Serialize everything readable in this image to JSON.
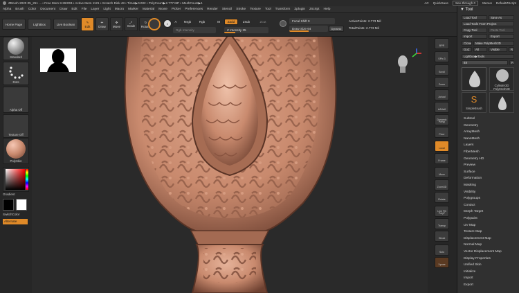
{
  "titlebar": {
    "text": "ZBrush 2020    05_251 ... • Free Mem 8.263GB • Active Mem 1121 • Scratch Disk 48 • Timer▶0.002 • PolyCount▶2.777 MP • MeshCount▶1",
    "ac": "AC",
    "quicksave": "QuickSave",
    "see_through": "See-through  0",
    "menus": "Menus",
    "script": "DefaultZScript"
  },
  "menubar": {
    "items": [
      "Alpha",
      "Brush",
      "Color",
      "Document",
      "Draw",
      "Edit",
      "File",
      "Layer",
      "Light",
      "Macro",
      "Marker",
      "Material",
      "Movie",
      "Picker",
      "Preferences",
      "Render",
      "Stencil",
      "Stroke",
      "Texture",
      "Tool",
      "Transform",
      "Zplugin",
      "Zscript",
      "Help"
    ]
  },
  "toolbar": {
    "home_page": "Home Page",
    "lightbox": "LightBox",
    "live_boolean": "Live Boolean",
    "edit": "Edit",
    "draw": "Draw",
    "move": "Move",
    "scale": "Scale",
    "rotate": "Rotate",
    "a_label": "A",
    "mrgb": "Mrgb",
    "rgb": "Rgb",
    "m": "M",
    "zadd": "Zadd",
    "zsub": "Zsub",
    "zcut": "Zcut",
    "rgb_intensity": "Rgb Intensity",
    "z_intensity": "Z Intensity 25",
    "focal_shift": "Focal Shift 0",
    "draw_size": "Draw Size 64",
    "dynamic": "Dynamic",
    "active_points": "ActivePoints: 2.773 Mil",
    "total_points": "TotalPoints: 2.773 Mil"
  },
  "leftshelf": {
    "standard": "Standard",
    "dots": "Dots",
    "alpha_off": "Alpha Off",
    "texture_off": "Texture Off",
    "polyskin": "PolySkin",
    "gradient": "Gradient",
    "switchcolor": "SwitchColor",
    "alternate": "Alternate"
  },
  "rightshelf": {
    "items": [
      "BPR",
      "SPix 3",
      "Scroll",
      "Zoom",
      "Actual",
      "AAHalf",
      "Dynamic Persp",
      "Floor",
      "Local",
      "Frame",
      "Move",
      "Zoom3D",
      "Rotate",
      "Line Fill PolyF",
      "Transp",
      "Ghost",
      "Solo",
      "Xpose"
    ]
  },
  "toolpanel": {
    "title": "Tool",
    "load_tool": "Load Tool",
    "save_as": "Save As",
    "load_from_project": "Load Tools From Project",
    "copy_tool": "Copy Tool",
    "paste_tool": "Paste Tool",
    "import": "Import",
    "export": "Export",
    "clone": "Clone",
    "make_polymesh": "Make PolyMesh3D",
    "goz": "GoZ",
    "all": "All",
    "visible": "Visible",
    "r": "R",
    "lightbox_tools": "Lightbox▶Tools",
    "tool_count": "48",
    "r2": "R",
    "thumbs": [
      "Cylinder3D",
      "PolyMesh3D",
      "SimpleBrush"
    ],
    "menu": [
      "Subtool",
      "Geometry",
      "ArrayMesh",
      "NanoMesh",
      "Layers",
      "FiberMesh",
      "Geometry HD",
      "Preview",
      "Surface",
      "Deformation",
      "Masking",
      "Visibility",
      "Polygroups",
      "Contact",
      "Morph Target",
      "Polypaint",
      "UV Map",
      "Texture Map",
      "Displacement Map",
      "Normal Map",
      "Vector Displacement Map",
      "Display Properties",
      "Unified Skin",
      "Initialize",
      "Import",
      "Export"
    ]
  },
  "colors": {
    "accent": "#e08a28",
    "copper": "#c98a6e",
    "canvas": "#2a2a2a"
  }
}
